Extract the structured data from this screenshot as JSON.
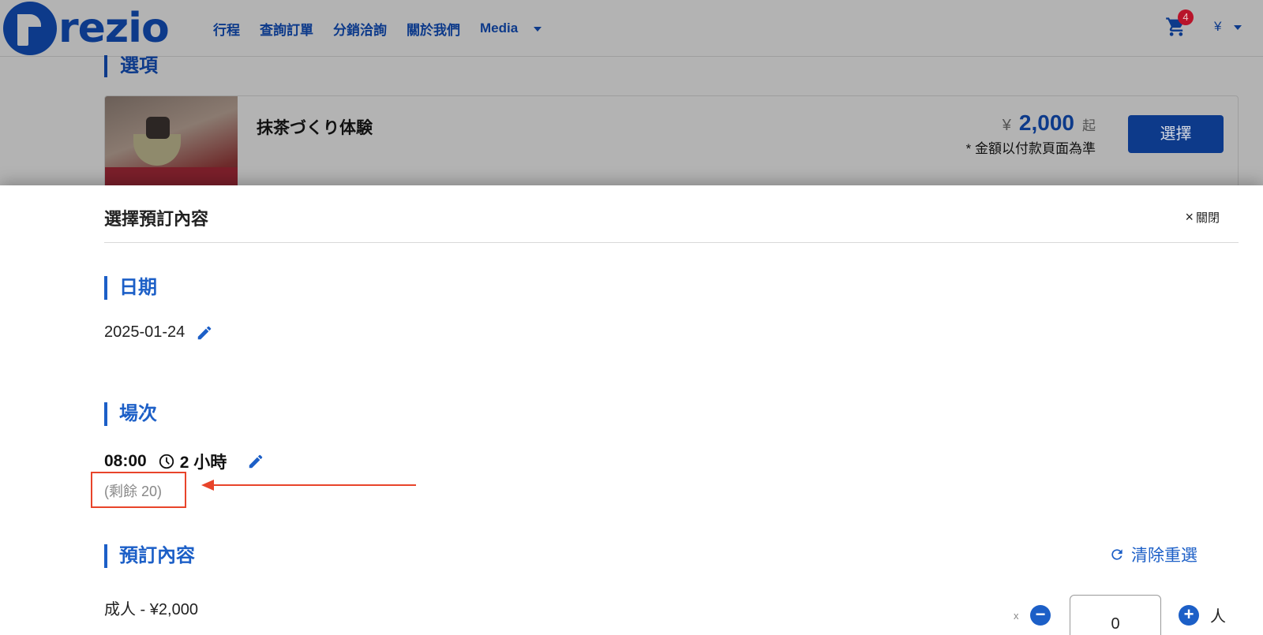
{
  "header": {
    "logo_text": "rezio",
    "nav": [
      "行程",
      "查詢訂單",
      "分銷洽詢",
      "關於我們",
      "Media"
    ],
    "cart_count": "4",
    "currency": "¥"
  },
  "options_section": {
    "title": "選項",
    "product_name": "抹茶づくり体験",
    "price_symbol": "¥",
    "price": "2,000",
    "price_suffix": "起",
    "price_note": "* 金額以付款頁面為準",
    "select_label": "選擇"
  },
  "modal": {
    "title": "選擇預訂內容",
    "close_label": "關閉",
    "date_section": {
      "title": "日期",
      "value": "2025-01-24"
    },
    "session_section": {
      "title": "場次",
      "time": "08:00",
      "duration": "2 小時",
      "remaining": "(剩餘 20)"
    },
    "booking_section": {
      "title": "預訂內容",
      "clear_label": "清除重選",
      "ticket_label": "成人 - ¥2,000",
      "qty_times": "x",
      "qty_value": "0",
      "qty_unit": "人"
    }
  },
  "annotation": {
    "color": "#e8442a"
  },
  "colors": {
    "brand": "#1c5fc7",
    "brand_dark": "#0d3a8a",
    "badge": "#b8142a"
  }
}
